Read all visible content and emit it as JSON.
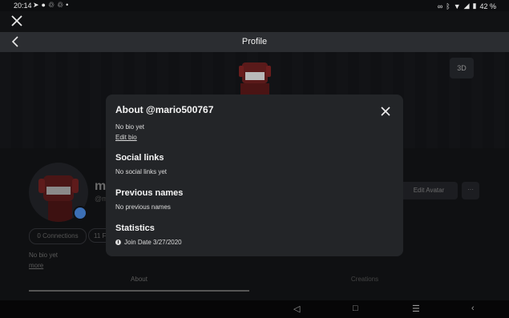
{
  "status_bar": {
    "time": "20:14",
    "left_icons": [
      "navigation-icon",
      "chat-icon",
      "sync-icon",
      "sync-icon",
      "dot-icon"
    ],
    "right_icons": [
      "link-icon",
      "bluetooth-icon",
      "wifi-icon",
      "signal-icon"
    ],
    "battery": "42 %"
  },
  "nav": {
    "title": "Profile"
  },
  "background": {
    "btn_3d": "3D",
    "name_partial": "m",
    "handle_partial": "@m",
    "edit_avatar": "Edit Avatar",
    "more": "···",
    "connections": "0 Connections",
    "followers_partial": "11 Fo",
    "bio": "No bio yet",
    "more_link": "more",
    "tabs": [
      "About",
      "Creations"
    ]
  },
  "modal": {
    "title": "About @mario500767",
    "bio": "No bio yet",
    "edit_bio": "Edit bio",
    "social_heading": "Social links",
    "social_text": "No social links yet",
    "prev_heading": "Previous names",
    "prev_text": "No previous names",
    "stats_heading": "Statistics",
    "join_date": "Join Date 3/27/2020"
  },
  "system_nav": {
    "icons": [
      "back-triangle-icon",
      "home-square-icon",
      "recents-icon",
      "chevron-left-icon"
    ]
  },
  "colors": {
    "modal_bg": "#232528",
    "page_bg": "#0f1012",
    "navbar_bg": "#2b2d31"
  }
}
